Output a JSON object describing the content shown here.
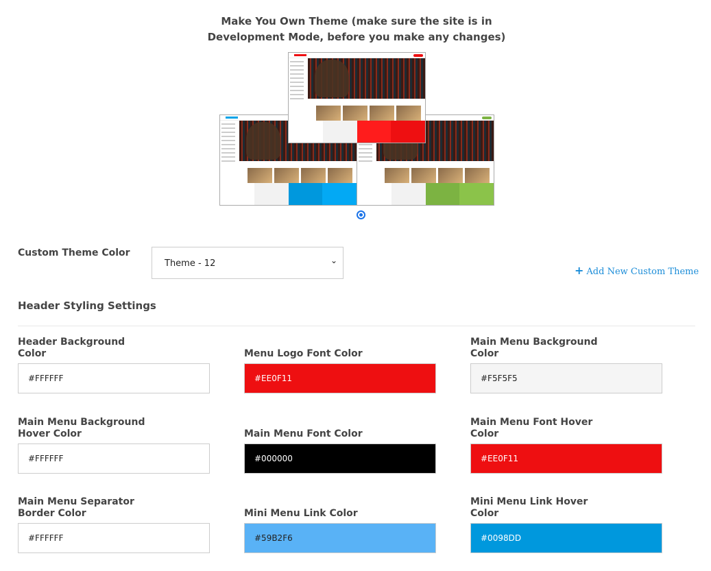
{
  "title_line1": "Make You Own Theme (make sure the site is in",
  "title_line2": "Development Mode, before you make any changes)",
  "previews": [
    {
      "accent": "#00A3E8",
      "colors": [
        "#FFFFFF",
        "#F2F2F2",
        "#0098DD",
        "#03A9F4"
      ]
    },
    {
      "accent": "#7CB342",
      "colors": [
        "#FFFFFF",
        "#F2F2F2",
        "#7CB342",
        "#8BC34A"
      ]
    },
    {
      "accent": "#EE0F11",
      "colors": [
        "#FFFFFF",
        "#F2F2F2",
        "#FF1C1C",
        "#EE0F11"
      ]
    }
  ],
  "custom_theme": {
    "label": "Custom Theme Color",
    "selected": "Theme - 12",
    "add_link": "Add New Custom Theme"
  },
  "section_title": "Header Styling Settings",
  "fields": [
    {
      "label": "Header Background Color",
      "value": "#FFFFFF",
      "bg": "#FFFFFF",
      "fg": "#222222"
    },
    {
      "label": "Menu Logo Font Color",
      "value": "#EE0F11",
      "bg": "#EE0F11",
      "fg": "#FFFFFF"
    },
    {
      "label": "Main Menu Background Color",
      "value": "#F5F5F5",
      "bg": "#F5F5F5",
      "fg": "#222222"
    },
    {
      "label": "Main Menu Background Hover Color",
      "value": "#FFFFFF",
      "bg": "#FFFFFF",
      "fg": "#222222"
    },
    {
      "label": "Main Menu Font Color",
      "value": "#000000",
      "bg": "#000000",
      "fg": "#FFFFFF"
    },
    {
      "label": "Main Menu Font Hover Color",
      "value": "#EE0F11",
      "bg": "#EE0F11",
      "fg": "#FFFFFF"
    },
    {
      "label": "Main Menu Separator Border Color",
      "value": "#FFFFFF",
      "bg": "#FFFFFF",
      "fg": "#222222"
    },
    {
      "label": "Mini Menu Link Color",
      "value": "#59B2F6",
      "bg": "#59B2F6",
      "fg": "#222222"
    },
    {
      "label": "Mini Menu Link Hover Color",
      "value": "#0098DD",
      "bg": "#0098DD",
      "fg": "#FFFFFF"
    }
  ]
}
